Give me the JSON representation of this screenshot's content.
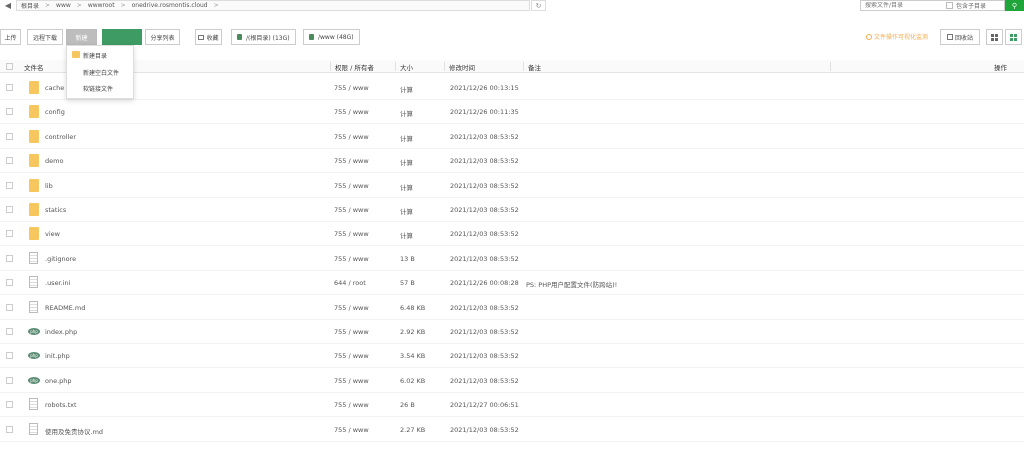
{
  "breadcrumb": {
    "items": [
      "根目录",
      "www",
      "wwwroot",
      "onedrive.rosmontis.cloud"
    ],
    "separator": ">"
  },
  "search": {
    "placeholder": "搜索文件/目录",
    "subdir_label": "包含子目录"
  },
  "toolbar": {
    "upload": "上传",
    "remote_download": "远程下载",
    "new_label": "新建",
    "share_list": "分享列表",
    "favorites": "收藏",
    "disk_root": "/(根目录) (13G)",
    "disk_www": "/www (48G)",
    "warning": "文件操作可视化监测",
    "recycle": "回收站"
  },
  "dropdown": {
    "items": [
      "新建目录",
      "新建空白文件",
      "软链接文件"
    ]
  },
  "table": {
    "headers": [
      "文件名",
      "权限 / 所有者",
      "大小",
      "修改时间",
      "备注",
      "操作"
    ],
    "rows": [
      {
        "name": "cache",
        "perm": "755 / www",
        "size": "计算",
        "time": "2021/12/26 00:13:15",
        "note": "",
        "type": "folder"
      },
      {
        "name": "config",
        "perm": "755 / www",
        "size": "计算",
        "time": "2021/12/26 00:11:35",
        "note": "",
        "type": "folder"
      },
      {
        "name": "controller",
        "perm": "755 / www",
        "size": "计算",
        "time": "2021/12/03 08:53:52",
        "note": "",
        "type": "folder"
      },
      {
        "name": "demo",
        "perm": "755 / www",
        "size": "计算",
        "time": "2021/12/03 08:53:52",
        "note": "",
        "type": "folder"
      },
      {
        "name": "lib",
        "perm": "755 / www",
        "size": "计算",
        "time": "2021/12/03 08:53:52",
        "note": "",
        "type": "folder"
      },
      {
        "name": "statics",
        "perm": "755 / www",
        "size": "计算",
        "time": "2021/12/03 08:53:52",
        "note": "",
        "type": "folder"
      },
      {
        "name": "view",
        "perm": "755 / www",
        "size": "计算",
        "time": "2021/12/03 08:53:52",
        "note": "",
        "type": "folder"
      },
      {
        "name": ".gitignore",
        "perm": "755 / www",
        "size": "13 B",
        "time": "2021/12/03 08:53:52",
        "note": "",
        "type": "file"
      },
      {
        "name": ".user.ini",
        "perm": "644 / root",
        "size": "57 B",
        "time": "2021/12/26 00:08:28",
        "note": "PS: PHP用户配置文件(防跨站)!",
        "type": "file"
      },
      {
        "name": "README.md",
        "perm": "755 / www",
        "size": "6.48 KB",
        "time": "2021/12/03 08:53:52",
        "note": "",
        "type": "file"
      },
      {
        "name": "index.php",
        "perm": "755 / www",
        "size": "2.92 KB",
        "time": "2021/12/03 08:53:52",
        "note": "",
        "type": "php"
      },
      {
        "name": "init.php",
        "perm": "755 / www",
        "size": "3.54 KB",
        "time": "2021/12/03 08:53:52",
        "note": "",
        "type": "php"
      },
      {
        "name": "one.php",
        "perm": "755 / www",
        "size": "6.02 KB",
        "time": "2021/12/03 08:53:52",
        "note": "",
        "type": "php"
      },
      {
        "name": "robots.txt",
        "perm": "755 / www",
        "size": "26 B",
        "time": "2021/12/27 00:06:51",
        "note": "",
        "type": "file"
      },
      {
        "name": "使用及免责协议.md",
        "perm": "755 / www",
        "size": "2.27 KB",
        "time": "2021/12/03 08:53:52",
        "note": "",
        "type": "file"
      }
    ]
  },
  "colors": {
    "accent": "#20a53a",
    "folder": "#f6c75e",
    "warning": "#f0ad4e"
  }
}
